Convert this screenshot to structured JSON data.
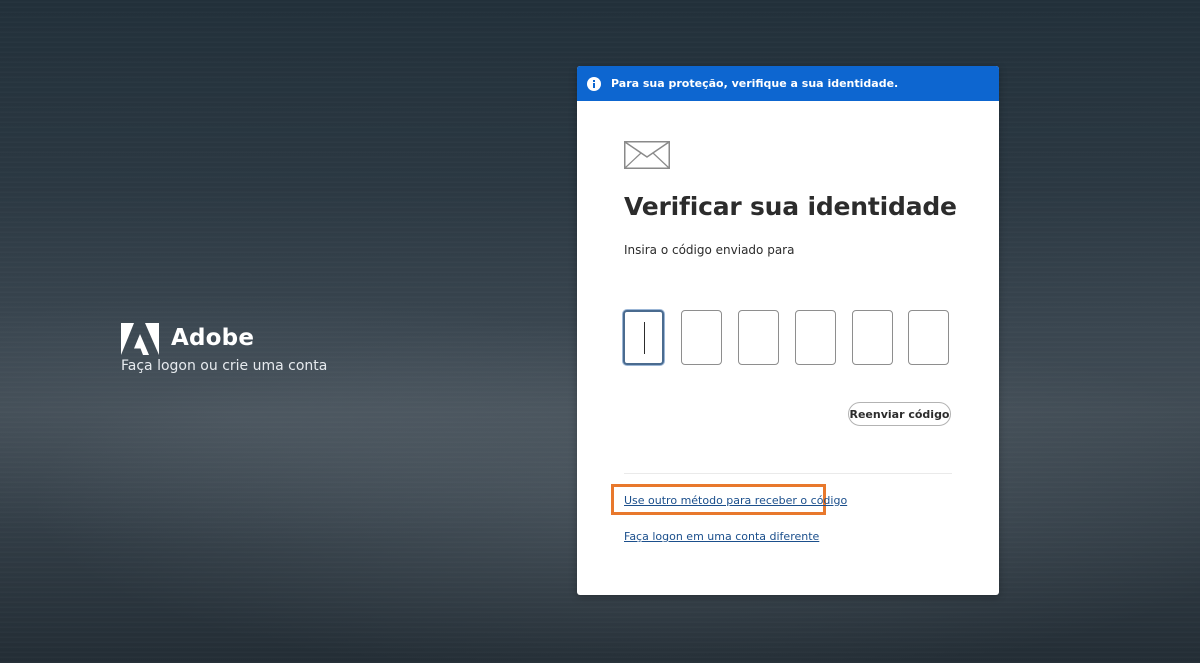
{
  "brand": {
    "name": "Adobe",
    "tagline": "Faça logon ou crie uma conta",
    "logo_icon": "adobe-logo-icon"
  },
  "banner": {
    "icon": "info-icon",
    "text": "Para sua proteção, verifique a sua identidade.",
    "color": "#0d66d0"
  },
  "card": {
    "icon": "envelope-icon",
    "title": "Verificar sua identidade",
    "subtitle": "Insira o código enviado para",
    "code_digits": [
      "",
      "",
      "",
      "",
      "",
      ""
    ],
    "active_digit": 1,
    "resend_label": "Reenviar código",
    "alt_method_link": "Use outro método para receber o código",
    "other_account_link": "Faça logon em uma conta diferente"
  },
  "colors": {
    "accent": "#0d66d0",
    "highlight": "#e8782c",
    "link": "#1b4f8c"
  }
}
